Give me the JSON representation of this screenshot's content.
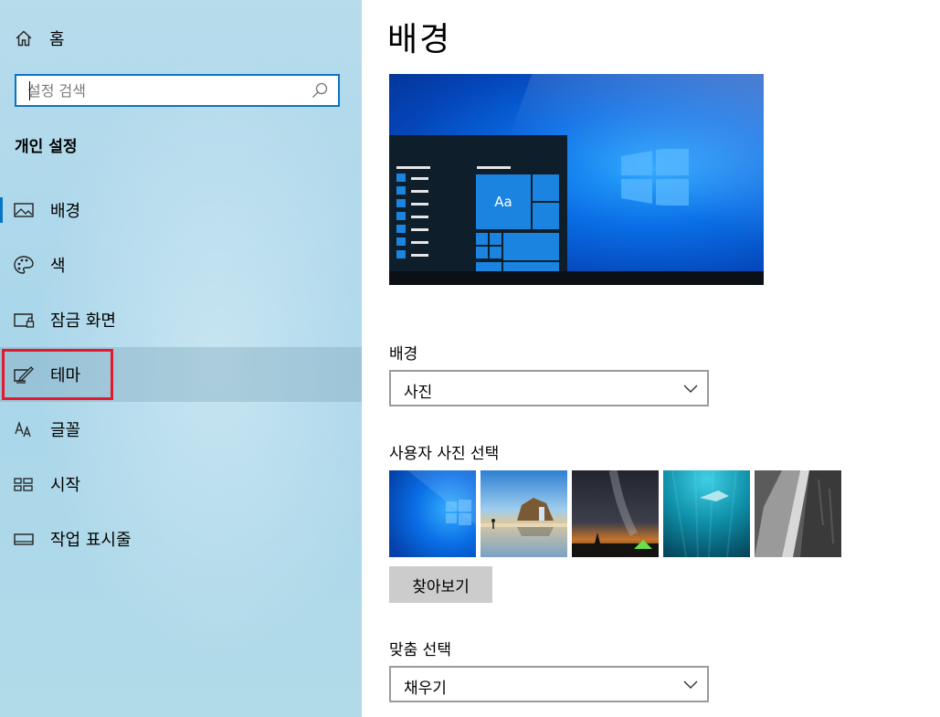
{
  "sidebar": {
    "home_label": "홈",
    "search_placeholder": "설정 검색",
    "section_title": "개인 설정",
    "items": [
      {
        "label": "배경",
        "icon": "picture-icon"
      },
      {
        "label": "색",
        "icon": "palette-icon"
      },
      {
        "label": "잠금 화면",
        "icon": "lock-screen-icon"
      },
      {
        "label": "테마",
        "icon": "theme-brush-icon"
      },
      {
        "label": "글꼴",
        "icon": "font-icon"
      },
      {
        "label": "시작",
        "icon": "start-icon"
      },
      {
        "label": "작업 표시줄",
        "icon": "taskbar-icon"
      }
    ],
    "selected_index": 3
  },
  "main": {
    "title": "배경",
    "preview_tile_label": "Aa",
    "background_label": "배경",
    "background_value": "사진",
    "choose_picture_label": "사용자 사진 선택",
    "pictures": [
      "windows-blue-light",
      "beach-rock-arch",
      "milky-way-tent",
      "underwater-swimmer",
      "rock-cliff"
    ],
    "browse_label": "찾아보기",
    "fit_label": "맞춤 선택",
    "fit_value": "채우기"
  },
  "colors": {
    "accent": "#0a74c7",
    "highlight_box": "#e3192f"
  }
}
